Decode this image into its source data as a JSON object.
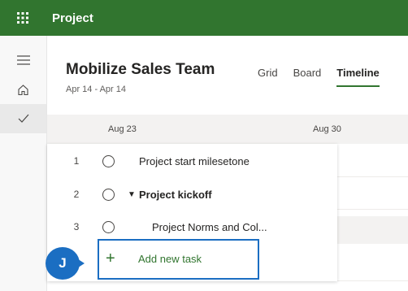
{
  "app": {
    "title": "Project",
    "topbar_color": "#31752f",
    "launcher_icon": "waffle-icon"
  },
  "rail": {
    "items": [
      {
        "icon": "hamburger-icon"
      },
      {
        "icon": "home-icon"
      },
      {
        "icon": "checkmark-icon",
        "active": true
      }
    ]
  },
  "plan": {
    "title": "Mobilize Sales Team",
    "dates": "Apr 14 - Apr 14"
  },
  "tabs": [
    {
      "label": "Grid",
      "active": false
    },
    {
      "label": "Board",
      "active": false
    },
    {
      "label": "Timeline",
      "active": true
    }
  ],
  "timeline": {
    "dates": [
      "Aug 23",
      "Aug 30"
    ]
  },
  "tasks": [
    {
      "num": "1",
      "name": "Project start milesetone",
      "bold": false,
      "expandable": false,
      "indent": 0
    },
    {
      "num": "2",
      "name": "Project kickoff",
      "bold": true,
      "expandable": true,
      "indent": 0
    },
    {
      "num": "3",
      "name": "Project Norms and Col...",
      "bold": false,
      "expandable": false,
      "indent": 1
    }
  ],
  "add_task": {
    "label": "Add new task",
    "icon": "plus-icon"
  },
  "callout": {
    "letter": "J",
    "color": "#1b6ec2"
  }
}
